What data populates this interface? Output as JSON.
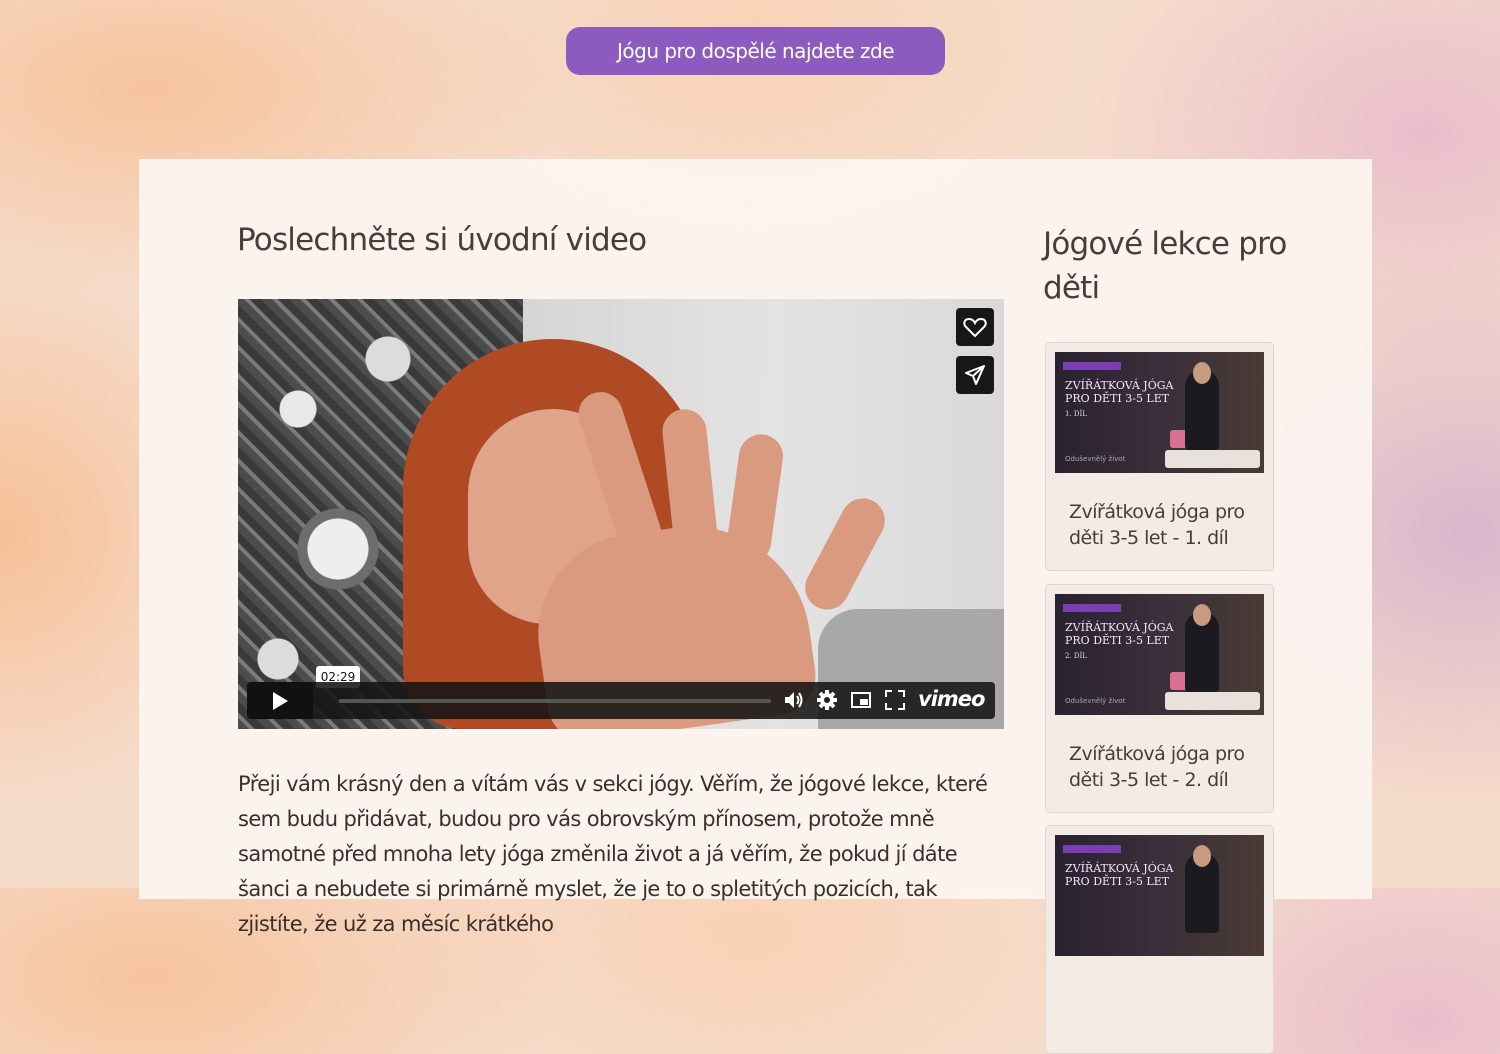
{
  "header": {
    "adult_yoga_button": "Jógu pro dospělé najdete zde"
  },
  "main": {
    "title": "Poslechněte si úvodní video",
    "video": {
      "time_tooltip": "02:29",
      "brand": "vimeo"
    },
    "intro_text": "Přeji vám krásný den a vítám vás v sekci jógy. Věřím, že jógové lekce, které sem budu přidávat, budou pro vás obrovským přínosem, protože mně samotné před mnoha lety jóga změnila život a já věřím, že pokud jí dáte šanci a nebudete si primárně myslet, že je to o spletitých pozicích, tak zjistíte, že už za měsíc krátkého"
  },
  "sidebar": {
    "title": "Jógové lekce pro děti",
    "lessons": [
      {
        "thumb_badge": "JÓGOVÉ LEKCE S LIBOU",
        "thumb_title": "ZVÍŘÁTKOVÁ JÓGA PRO DĚTI 3-5 LET",
        "thumb_part": "1. DÍL",
        "thumb_logo": "Oduševnělý život",
        "title": "Zvířátková jóga pro děti 3-5 let - 1. díl"
      },
      {
        "thumb_badge": "JÓGOVÉ LEKCE S LIBOU",
        "thumb_title": "ZVÍŘÁTKOVÁ JÓGA PRO DĚTI 3-5 LET",
        "thumb_part": "2. DÍL",
        "thumb_logo": "Oduševnělý život",
        "title": "Zvířátková jóga pro děti 3-5 let - 2. díl"
      },
      {
        "thumb_badge": "JÓGOVÉ LEKCE S LIBOU",
        "thumb_title": "ZVÍŘÁTKOVÁ JÓGA PRO DĚTI 3-5 LET",
        "thumb_part": "",
        "thumb_logo": "",
        "title": ""
      }
    ]
  },
  "colors": {
    "accent": "#8d5bbf",
    "text": "#4a3c36",
    "panel": "#fcf6f2"
  }
}
